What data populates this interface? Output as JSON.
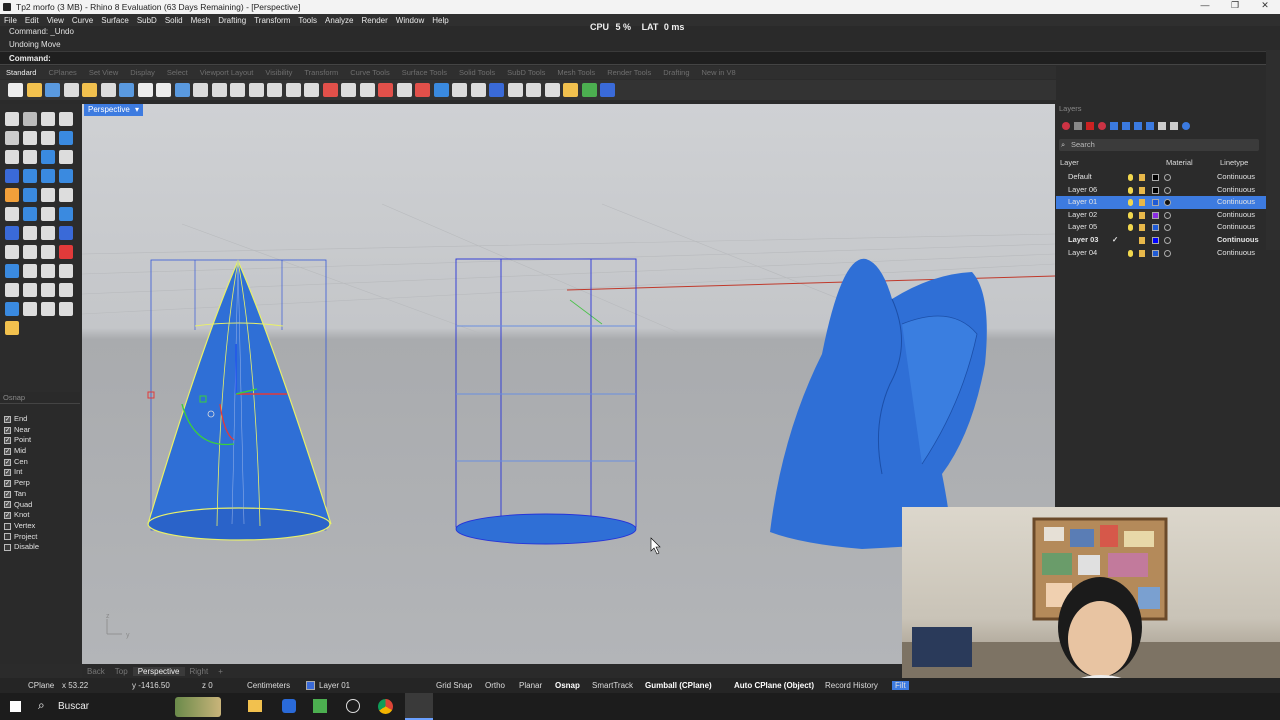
{
  "window": {
    "title": "Tp2 morfo (3 MB) - Rhino 8 Evaluation (63 Days Remaining) - [Perspective]",
    "controls": [
      "—",
      "❐",
      "✕"
    ]
  },
  "menu": [
    "File",
    "Edit",
    "View",
    "Curve",
    "Surface",
    "SubD",
    "Solid",
    "Mesh",
    "Drafting",
    "Transform",
    "Tools",
    "Analyze",
    "Render",
    "Window",
    "Help"
  ],
  "command_history": [
    "Command: _Undo",
    "Undoing Move"
  ],
  "command_prompt": "Command:",
  "perf": {
    "cpu_label": "CPU",
    "cpu_value": "5 %",
    "lat_label": "LAT",
    "lat_value": "0 ms"
  },
  "toolbar_tabs": [
    "Standard",
    "CPlanes",
    "Set View",
    "Display",
    "Select",
    "Viewport Layout",
    "Visibility",
    "Transform",
    "Curve Tools",
    "Surface Tools",
    "Solid Tools",
    "SubD Tools",
    "Mesh Tools",
    "Render Tools",
    "Drafting",
    "New in V8"
  ],
  "viewport": {
    "label": "Perspective",
    "axis_z": "z",
    "axis_y": "y"
  },
  "osnap": {
    "title": "Osnap",
    "items": [
      {
        "label": "End",
        "checked": true
      },
      {
        "label": "Near",
        "checked": true
      },
      {
        "label": "Point",
        "checked": true
      },
      {
        "label": "Mid",
        "checked": true
      },
      {
        "label": "Cen",
        "checked": true
      },
      {
        "label": "Int",
        "checked": true
      },
      {
        "label": "Perp",
        "checked": true
      },
      {
        "label": "Tan",
        "checked": true
      },
      {
        "label": "Quad",
        "checked": true
      },
      {
        "label": "Knot",
        "checked": true
      },
      {
        "label": "Vertex",
        "checked": false
      },
      {
        "label": "Project",
        "checked": false
      },
      {
        "label": "Disable",
        "checked": false
      }
    ]
  },
  "layers": {
    "title": "Layers",
    "search_placeholder": "Search",
    "col_layer": "Layer",
    "col_material": "Material",
    "col_linetype": "Linetype",
    "rows": [
      {
        "name": "Default",
        "color": "#000000",
        "linetype": "Continuous",
        "selected": false,
        "current": false
      },
      {
        "name": "Layer 06",
        "color": "#000000",
        "linetype": "Continuous",
        "selected": false,
        "current": false
      },
      {
        "name": "Layer 01",
        "color": "#1f5bd6",
        "linetype": "Continuous",
        "selected": true,
        "current": false
      },
      {
        "name": "Layer 02",
        "color": "#8a2be2",
        "linetype": "Continuous",
        "selected": false,
        "current": false
      },
      {
        "name": "Layer 05",
        "color": "#1f5bd6",
        "linetype": "Continuous",
        "selected": false,
        "current": false
      },
      {
        "name": "Layer 03",
        "color": "#0000ff",
        "linetype": "Continuous",
        "selected": false,
        "current": true
      },
      {
        "name": "Layer 04",
        "color": "#1f5bd6",
        "linetype": "Continuous",
        "selected": false,
        "current": false
      }
    ]
  },
  "viewport_tabs": [
    "Back",
    "Top",
    "Perspective",
    "Right",
    "+"
  ],
  "status": {
    "cplane": "CPlane",
    "x": "x 53.22",
    "y": "y -1416.50",
    "z": "z 0",
    "units": "Centimeters",
    "layer": "Layer 01",
    "grid_snap": "Grid Snap",
    "ortho": "Ortho",
    "planar": "Planar",
    "osnap": "Osnap",
    "smarttrack": "SmartTrack",
    "gumball": "Gumball (CPlane)",
    "auto_cplane": "Auto CPlane (Object)",
    "record_history": "Record History",
    "filter": "Filt"
  },
  "taskbar": {
    "search": "Buscar"
  },
  "colors": {
    "accent": "#3d7be0",
    "object_blue": "#2f6fd6",
    "selection_yellow": "#e8f06a"
  }
}
